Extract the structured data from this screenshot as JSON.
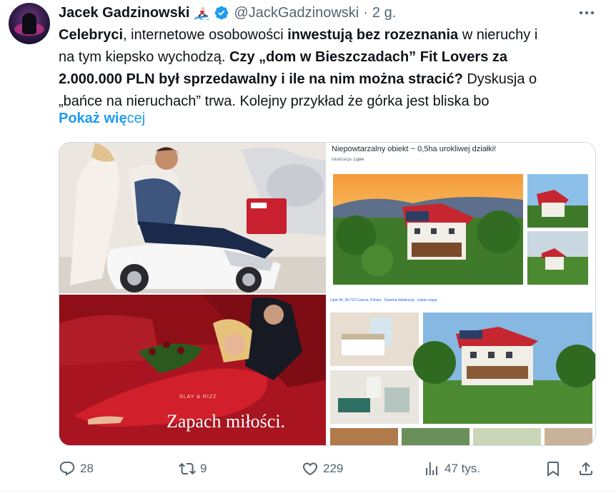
{
  "author": {
    "name": "Jacek Gadzinowski",
    "handle": "@JackGadzinowski",
    "separator": "·",
    "time": "2 g.",
    "verified": true,
    "avatar_icon": "avatar-photo",
    "emoji_icon": "surfer-emoji-icon"
  },
  "tweet": {
    "line1": [
      "Celebryci",
      ", internetowe osobowości ",
      "inwestują bez rozeznania",
      " w nieruchy i"
    ],
    "line2": [
      "na tym kiepsko wychodzą. ",
      "Czy „dom w Bieszczadach” Fit Lovers za"
    ],
    "line3": [
      "2.000.000 PLN był sprzedawalny i ile na nim można stracić?",
      " Dyskusja o"
    ],
    "line4": "„bańce na nieruchach” trwa. Kolejny przykład że górka jest bliska bo",
    "show_more_bold": "Pokaż wię",
    "show_more_rest": "cej"
  },
  "media": {
    "perfume_caption": "Zapach miłości.",
    "perfume_brand": "SLAY & RIZZ",
    "box_brand": "DKMS",
    "listing_title": "Niepowtarzalny obiekt ~ 0,5ha urokliwej działki!",
    "listing_loc_label": "lokalizacja:",
    "listing_loc_value": "Lipie",
    "listing_address": "Lipie 94, 38-710 Czarna, Polska · Świetna lokalizacja · pokaż mapę"
  },
  "actions": {
    "replies": "28",
    "retweets": "9",
    "likes": "229",
    "views": "47 tys.",
    "icons": [
      "reply-icon",
      "retweet-icon",
      "like-icon",
      "views-icon",
      "bookmark-icon",
      "share-icon"
    ]
  },
  "colors": {
    "accent": "#1d9bf0",
    "muted": "#536471",
    "text": "#0f1419",
    "border": "#cfd9de"
  }
}
